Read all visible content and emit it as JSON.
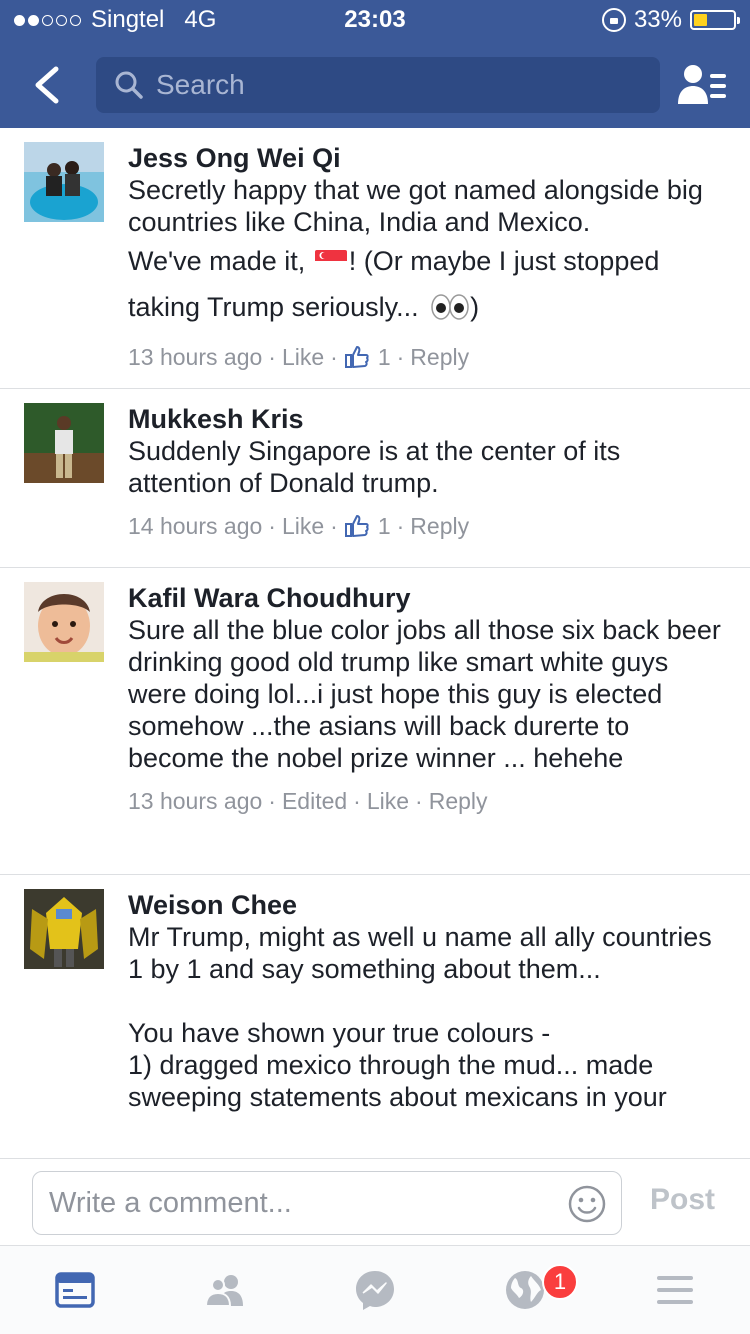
{
  "status_bar": {
    "carrier": "Singtel",
    "network": "4G",
    "time": "23:03",
    "battery": "33%",
    "battery_level": 0.33,
    "signal_bars_filled": 2,
    "signal_bars_total": 5
  },
  "header": {
    "search_placeholder": "Search"
  },
  "colors": {
    "brand": "#3b5998",
    "link_gray": "#90949c",
    "badge_red": "#fa3e3e",
    "like_blue": "#4267b2"
  },
  "comments": [
    {
      "author": "Jess Ong Wei Qi",
      "text_1": "Secretly happy that we got named alongside big countries like China, India and Mexico.",
      "text_2a": "We've made it, ",
      "text_2b": "! (Or maybe I just stopped taking Trump seriously... ",
      "text_2c": ")",
      "time": "13 hours ago",
      "like": "Like",
      "likes_count": "1",
      "reply": "Reply"
    },
    {
      "author": "Mukkesh Kris",
      "text": "Suddenly Singapore is at the center of its attention of Donald trump.",
      "time": "14 hours ago",
      "like": "Like",
      "likes_count": "1",
      "reply": "Reply"
    },
    {
      "author": "Kafil Wara Choudhury",
      "text": "Sure all the blue color jobs all those six back beer drinking good old trump like smart white guys were doing lol...i just hope this guy is elected somehow ...the asians will back durerte to become the nobel prize winner ... hehehe",
      "time": "13 hours ago",
      "edited": "Edited",
      "like": "Like",
      "reply": "Reply"
    },
    {
      "author": "Weison Chee",
      "text": "Mr Trump, might as well u name all ally countries 1 by 1 and say something about them...\n\nYou have shown your true colours -\n1) dragged mexico through the mud... made sweeping statements about mexicans in your"
    }
  ],
  "composer": {
    "placeholder": "Write a comment...",
    "post_label": "Post"
  },
  "tabbar": {
    "notifications_badge": "1",
    "tabs": [
      "news-feed",
      "friend-requests",
      "messenger",
      "notifications",
      "more"
    ]
  }
}
